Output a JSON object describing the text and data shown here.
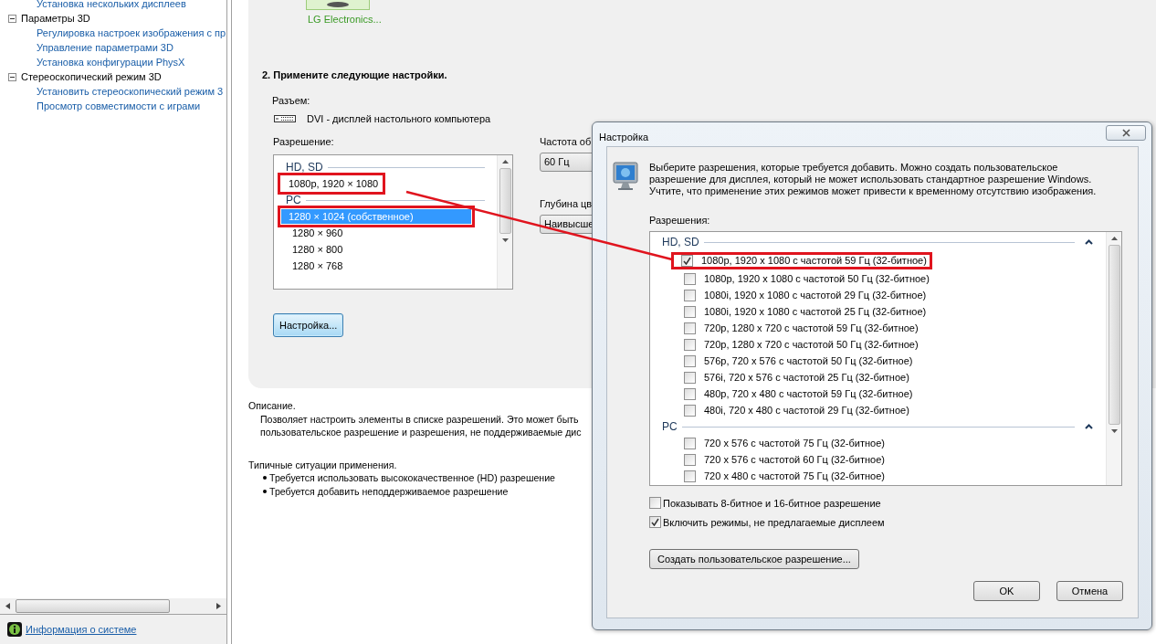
{
  "sidebar": {
    "tree": [
      {
        "kind": "link",
        "label": "Установка нескольких дисплеев"
      },
      {
        "kind": "group",
        "label": "Параметры 3D",
        "expanded": true,
        "children": [
          {
            "label": "Регулировка настроек изображения с пр"
          },
          {
            "label": "Управление параметрами 3D"
          },
          {
            "label": "Установка конфигурации PhysX"
          }
        ]
      },
      {
        "kind": "group",
        "label": "Стереоскопический режим 3D",
        "expanded": true,
        "children": [
          {
            "label": "Установить стереоскопический режим 3"
          },
          {
            "label": "Просмотр совместимости с играми"
          }
        ]
      }
    ],
    "footer_link": "Информация о системе"
  },
  "main": {
    "display_label": "LG Electronics...",
    "step_title": "2. Примените следующие настройки.",
    "connector_label": "Разъем:",
    "connector_value": "DVI - дисплей настольного компьютера",
    "resolution_label": "Разрешение:",
    "resolution_groups": [
      {
        "title": "HD, SD",
        "items": [
          {
            "label": "1080p, 1920 × 1080",
            "selected": false,
            "highlighted": true
          }
        ]
      },
      {
        "title": "PC",
        "items": [
          {
            "label": "1280 × 1024 (собственное)",
            "selected": true,
            "highlighted": true
          },
          {
            "label": "1280 × 960",
            "selected": false,
            "highlighted": false
          },
          {
            "label": "1280 × 800",
            "selected": false,
            "highlighted": false
          },
          {
            "label": "1280 × 768",
            "selected": false,
            "highlighted": false
          }
        ]
      }
    ],
    "refresh_label": "Частота об",
    "refresh_value": "60 Гц",
    "depth_label": "Глубина цв",
    "depth_value": "Наивысше",
    "customize_button": "Настройка...",
    "description_title": "Описание.",
    "description_lines": [
      "Позволяет настроить элементы в списке разрешений. Это может быть",
      "пользовательское разрешение и разрешения, не поддерживаемые дис"
    ],
    "usage_title": "Типичные ситуации применения.",
    "usage_items": [
      "Требуется использовать высококачественное (HD) разрешение",
      "Требуется добавить неподдерживаемое разрешение"
    ]
  },
  "dialog": {
    "title": "Настройка",
    "intro": "Выберите разрешения, которые требуется добавить. Можно создать пользовательское разрешение для дисплея, который не может использовать стандартное разрешение Windows. Учтите, что применение этих режимов может привести к временному отсутствию изображения.",
    "list_label": "Разрешения:",
    "groups": [
      {
        "title": "HD, SD",
        "expanded": true,
        "items": [
          {
            "label": "1080p, 1920 x 1080 с частотой 59 Гц (32-битное)",
            "checked": true,
            "highlighted": true
          },
          {
            "label": "1080p, 1920 x 1080 с частотой 50 Гц (32-битное)",
            "checked": false,
            "highlighted": false
          },
          {
            "label": "1080i, 1920 x 1080 с частотой 29 Гц (32-битное)",
            "checked": false,
            "highlighted": false
          },
          {
            "label": "1080i, 1920 x 1080 с частотой 25 Гц (32-битное)",
            "checked": false,
            "highlighted": false
          },
          {
            "label": "720p, 1280 x 720 с частотой 59 Гц (32-битное)",
            "checked": false,
            "highlighted": false
          },
          {
            "label": "720p, 1280 x 720 с частотой 50 Гц (32-битное)",
            "checked": false,
            "highlighted": false
          },
          {
            "label": "576p, 720 x 576 с частотой 50 Гц (32-битное)",
            "checked": false,
            "highlighted": false
          },
          {
            "label": "576i, 720 x 576 с частотой 25 Гц (32-битное)",
            "checked": false,
            "highlighted": false
          },
          {
            "label": "480p, 720 x 480 с частотой 59 Гц (32-битное)",
            "checked": false,
            "highlighted": false
          },
          {
            "label": "480i, 720 x 480 с частотой 29 Гц (32-битное)",
            "checked": false,
            "highlighted": false
          }
        ]
      },
      {
        "title": "PC",
        "expanded": true,
        "items": [
          {
            "label": "720 x 576 с частотой 75 Гц (32-битное)",
            "checked": false,
            "highlighted": false
          },
          {
            "label": "720 x 576 с частотой 60 Гц (32-битное)",
            "checked": false,
            "highlighted": false
          },
          {
            "label": "720 x 480 с частотой 75 Гц (32-битное)",
            "checked": false,
            "highlighted": false
          }
        ]
      }
    ],
    "options": [
      {
        "label": "Показывать 8-битное и 16-битное разрешение",
        "checked": false
      },
      {
        "label": "Включить режимы, не предлагаемые дисплеем",
        "checked": true
      }
    ],
    "custom_button": "Создать пользовательское разрешение...",
    "buttons": [
      "OK",
      "Отмена"
    ]
  }
}
